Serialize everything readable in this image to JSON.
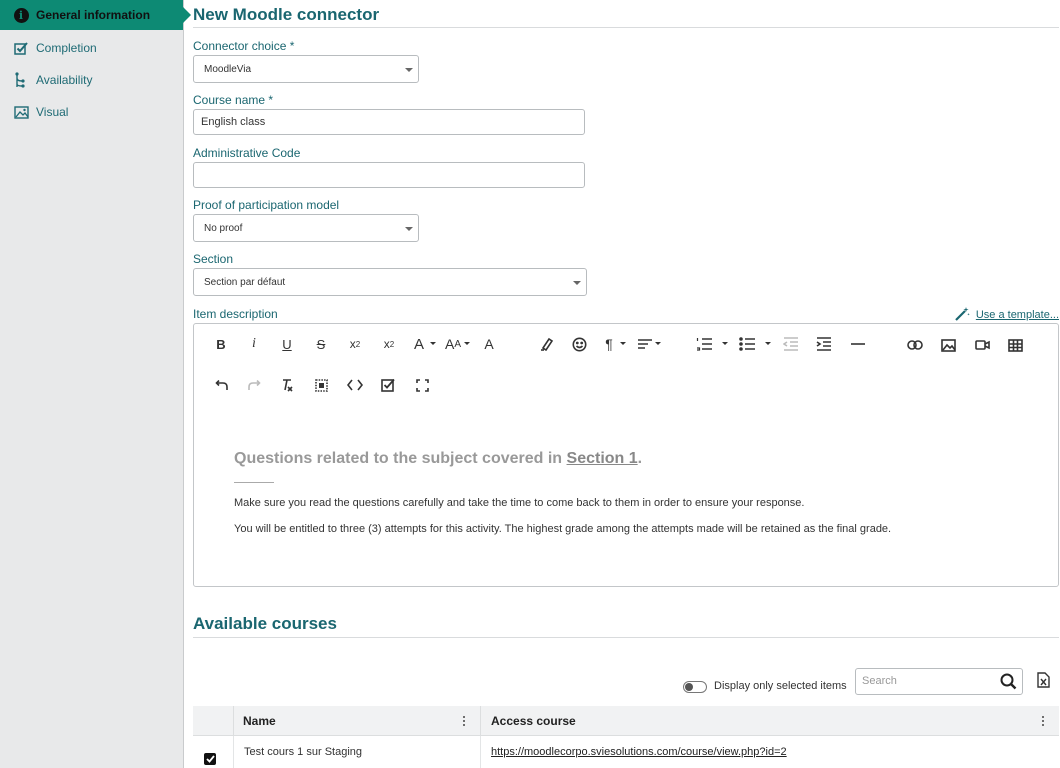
{
  "sidebar": {
    "items": [
      {
        "label": "General information",
        "icon": "info-icon",
        "active": true
      },
      {
        "label": "Completion",
        "icon": "checkbox-icon"
      },
      {
        "label": "Availability",
        "icon": "branch-icon"
      },
      {
        "label": "Visual",
        "icon": "image-icon"
      }
    ]
  },
  "page": {
    "title": "New Moodle connector"
  },
  "form": {
    "connector_label": "Connector choice *",
    "connector_value": "MoodleVia",
    "course_name_label": "Course name *",
    "course_name_value": "English class",
    "admin_code_label": "Administrative Code",
    "admin_code_value": "",
    "proof_label": "Proof of participation model",
    "proof_value": "No proof",
    "section_label": "Section",
    "section_value": "Section par défaut",
    "description_label": "Item description",
    "template_link": "Use a template..."
  },
  "editor": {
    "heading_prefix": "Questions related to the subject covered in ",
    "heading_link": "Section 1",
    "heading_suffix": ".",
    "paragraph1": "Make sure you read the questions carefully and take the time to come back to them in order to ensure your response.",
    "paragraph2": "You will be entitled to three (3) attempts for this activity. The highest grade among the attempts made will be retained as the final grade."
  },
  "courses": {
    "title": "Available courses",
    "toggle_label": "Display only selected items",
    "search_placeholder": "Search",
    "columns": [
      "Name",
      "Access course"
    ],
    "rows": [
      {
        "name": "Test cours 1 sur Staging",
        "url": "https://moodlecorpo.sviesolutions.com/course/view.php?id=2",
        "checked": true
      }
    ]
  },
  "colors": {
    "accent": "#0d8a74",
    "heading": "#1a6670",
    "sidebar_bg": "#e8e9ea"
  }
}
